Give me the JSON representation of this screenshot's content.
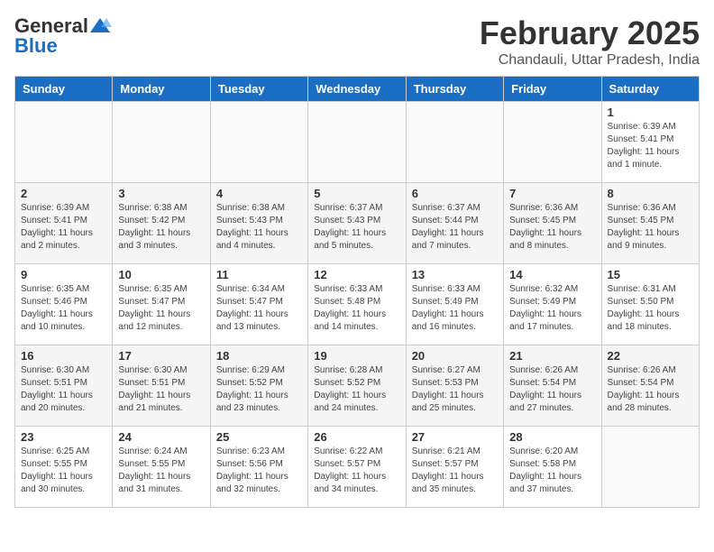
{
  "header": {
    "logo_general": "General",
    "logo_blue": "Blue",
    "title": "February 2025",
    "subtitle": "Chandauli, Uttar Pradesh, India"
  },
  "weekdays": [
    "Sunday",
    "Monday",
    "Tuesday",
    "Wednesday",
    "Thursday",
    "Friday",
    "Saturday"
  ],
  "weeks": [
    [
      {
        "day": "",
        "info": ""
      },
      {
        "day": "",
        "info": ""
      },
      {
        "day": "",
        "info": ""
      },
      {
        "day": "",
        "info": ""
      },
      {
        "day": "",
        "info": ""
      },
      {
        "day": "",
        "info": ""
      },
      {
        "day": "1",
        "info": "Sunrise: 6:39 AM\nSunset: 5:41 PM\nDaylight: 11 hours and 1 minute."
      }
    ],
    [
      {
        "day": "2",
        "info": "Sunrise: 6:39 AM\nSunset: 5:41 PM\nDaylight: 11 hours and 2 minutes."
      },
      {
        "day": "3",
        "info": "Sunrise: 6:38 AM\nSunset: 5:42 PM\nDaylight: 11 hours and 3 minutes."
      },
      {
        "day": "4",
        "info": "Sunrise: 6:38 AM\nSunset: 5:43 PM\nDaylight: 11 hours and 4 minutes."
      },
      {
        "day": "5",
        "info": "Sunrise: 6:37 AM\nSunset: 5:43 PM\nDaylight: 11 hours and 5 minutes."
      },
      {
        "day": "6",
        "info": "Sunrise: 6:37 AM\nSunset: 5:44 PM\nDaylight: 11 hours and 7 minutes."
      },
      {
        "day": "7",
        "info": "Sunrise: 6:36 AM\nSunset: 5:45 PM\nDaylight: 11 hours and 8 minutes."
      },
      {
        "day": "8",
        "info": "Sunrise: 6:36 AM\nSunset: 5:45 PM\nDaylight: 11 hours and 9 minutes."
      }
    ],
    [
      {
        "day": "9",
        "info": "Sunrise: 6:35 AM\nSunset: 5:46 PM\nDaylight: 11 hours and 10 minutes."
      },
      {
        "day": "10",
        "info": "Sunrise: 6:35 AM\nSunset: 5:47 PM\nDaylight: 11 hours and 12 minutes."
      },
      {
        "day": "11",
        "info": "Sunrise: 6:34 AM\nSunset: 5:47 PM\nDaylight: 11 hours and 13 minutes."
      },
      {
        "day": "12",
        "info": "Sunrise: 6:33 AM\nSunset: 5:48 PM\nDaylight: 11 hours and 14 minutes."
      },
      {
        "day": "13",
        "info": "Sunrise: 6:33 AM\nSunset: 5:49 PM\nDaylight: 11 hours and 16 minutes."
      },
      {
        "day": "14",
        "info": "Sunrise: 6:32 AM\nSunset: 5:49 PM\nDaylight: 11 hours and 17 minutes."
      },
      {
        "day": "15",
        "info": "Sunrise: 6:31 AM\nSunset: 5:50 PM\nDaylight: 11 hours and 18 minutes."
      }
    ],
    [
      {
        "day": "16",
        "info": "Sunrise: 6:30 AM\nSunset: 5:51 PM\nDaylight: 11 hours and 20 minutes."
      },
      {
        "day": "17",
        "info": "Sunrise: 6:30 AM\nSunset: 5:51 PM\nDaylight: 11 hours and 21 minutes."
      },
      {
        "day": "18",
        "info": "Sunrise: 6:29 AM\nSunset: 5:52 PM\nDaylight: 11 hours and 23 minutes."
      },
      {
        "day": "19",
        "info": "Sunrise: 6:28 AM\nSunset: 5:52 PM\nDaylight: 11 hours and 24 minutes."
      },
      {
        "day": "20",
        "info": "Sunrise: 6:27 AM\nSunset: 5:53 PM\nDaylight: 11 hours and 25 minutes."
      },
      {
        "day": "21",
        "info": "Sunrise: 6:26 AM\nSunset: 5:54 PM\nDaylight: 11 hours and 27 minutes."
      },
      {
        "day": "22",
        "info": "Sunrise: 6:26 AM\nSunset: 5:54 PM\nDaylight: 11 hours and 28 minutes."
      }
    ],
    [
      {
        "day": "23",
        "info": "Sunrise: 6:25 AM\nSunset: 5:55 PM\nDaylight: 11 hours and 30 minutes."
      },
      {
        "day": "24",
        "info": "Sunrise: 6:24 AM\nSunset: 5:55 PM\nDaylight: 11 hours and 31 minutes."
      },
      {
        "day": "25",
        "info": "Sunrise: 6:23 AM\nSunset: 5:56 PM\nDaylight: 11 hours and 32 minutes."
      },
      {
        "day": "26",
        "info": "Sunrise: 6:22 AM\nSunset: 5:57 PM\nDaylight: 11 hours and 34 minutes."
      },
      {
        "day": "27",
        "info": "Sunrise: 6:21 AM\nSunset: 5:57 PM\nDaylight: 11 hours and 35 minutes."
      },
      {
        "day": "28",
        "info": "Sunrise: 6:20 AM\nSunset: 5:58 PM\nDaylight: 11 hours and 37 minutes."
      },
      {
        "day": "",
        "info": ""
      }
    ]
  ]
}
